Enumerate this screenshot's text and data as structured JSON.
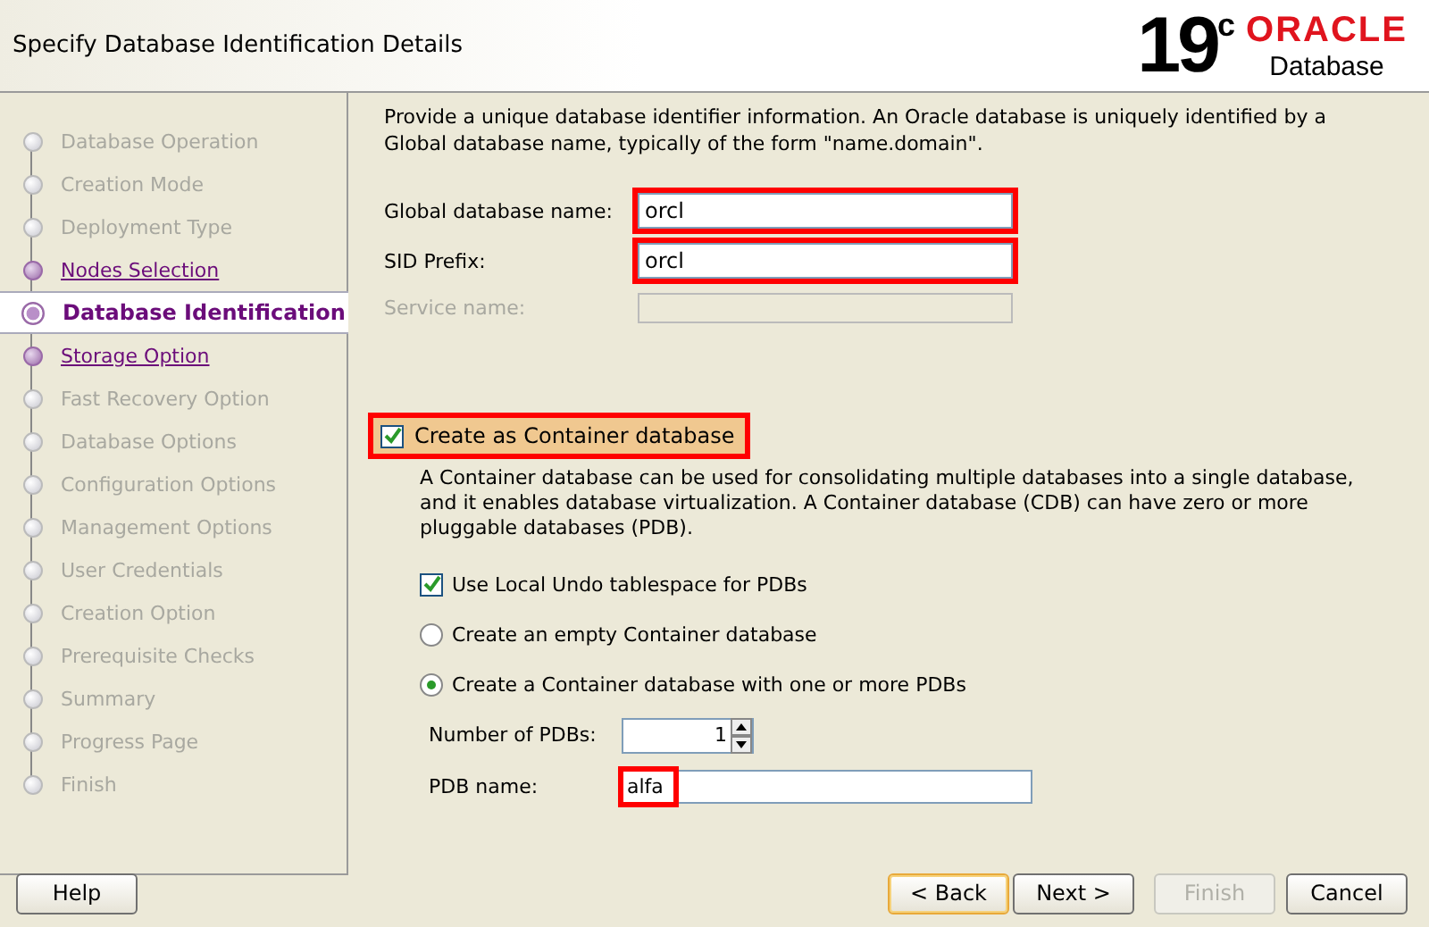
{
  "header": {
    "title": "Specify Database Identification Details",
    "logo": {
      "version": "19",
      "version_suffix": "c",
      "brand": "ORACLE",
      "product": "Database"
    }
  },
  "steps": [
    {
      "label": "Database Operation",
      "visited": false,
      "selected": false
    },
    {
      "label": "Creation Mode",
      "visited": false,
      "selected": false
    },
    {
      "label": "Deployment Type",
      "visited": false,
      "selected": false
    },
    {
      "label": "Nodes Selection",
      "visited": true,
      "selected": false
    },
    {
      "label": "Database Identification",
      "visited": false,
      "selected": true
    },
    {
      "label": "Storage Option",
      "visited": true,
      "selected": false
    },
    {
      "label": "Fast Recovery Option",
      "visited": false,
      "selected": false
    },
    {
      "label": "Database Options",
      "visited": false,
      "selected": false
    },
    {
      "label": "Configuration Options",
      "visited": false,
      "selected": false
    },
    {
      "label": "Management Options",
      "visited": false,
      "selected": false
    },
    {
      "label": "User Credentials",
      "visited": false,
      "selected": false
    },
    {
      "label": "Creation Option",
      "visited": false,
      "selected": false
    },
    {
      "label": "Prerequisite Checks",
      "visited": false,
      "selected": false
    },
    {
      "label": "Summary",
      "visited": false,
      "selected": false
    },
    {
      "label": "Progress Page",
      "visited": false,
      "selected": false
    },
    {
      "label": "Finish",
      "visited": false,
      "selected": false
    }
  ],
  "intro": "Provide a unique database identifier information. An Oracle database is uniquely identified by a Global database name, typically of the form \"name.domain\".",
  "fields": [
    {
      "label": "Global database name:",
      "value": "orcl",
      "disabled": false
    },
    {
      "label": "SID Prefix:",
      "value": "orcl",
      "disabled": false
    },
    {
      "label": "Service name:",
      "disabled": true
    }
  ],
  "container": {
    "label": "Create as Container database",
    "checked": true,
    "highlighted": true,
    "description": "A Container database can be used for consolidating multiple databases into a single database, and it enables database virtualization. A Container database (CDB) can have zero or more pluggable databases (PDB).",
    "options": [
      {
        "kind": "checkbox",
        "label": "Use Local Undo tablespace for PDBs",
        "checked": true
      },
      {
        "kind": "radio",
        "label": "Create an empty Container database",
        "selected": false
      },
      {
        "kind": "radio",
        "label": "Create a Container database with one or more PDBs",
        "selected": true
      }
    ],
    "pdb_count": {
      "label": "Number of PDBs:",
      "value": "1"
    },
    "pdb_name": {
      "label": "PDB name:",
      "value": "alfa",
      "highlighted": true
    }
  },
  "buttons": [
    {
      "label": "Help",
      "disabled": false,
      "default": false
    },
    {
      "label": "< Back",
      "disabled": false,
      "default": true
    },
    {
      "label": "Next >",
      "disabled": false,
      "default": false
    },
    {
      "label": "Finish",
      "disabled": true,
      "default": false
    },
    {
      "label": "Cancel",
      "disabled": false,
      "default": false
    }
  ]
}
